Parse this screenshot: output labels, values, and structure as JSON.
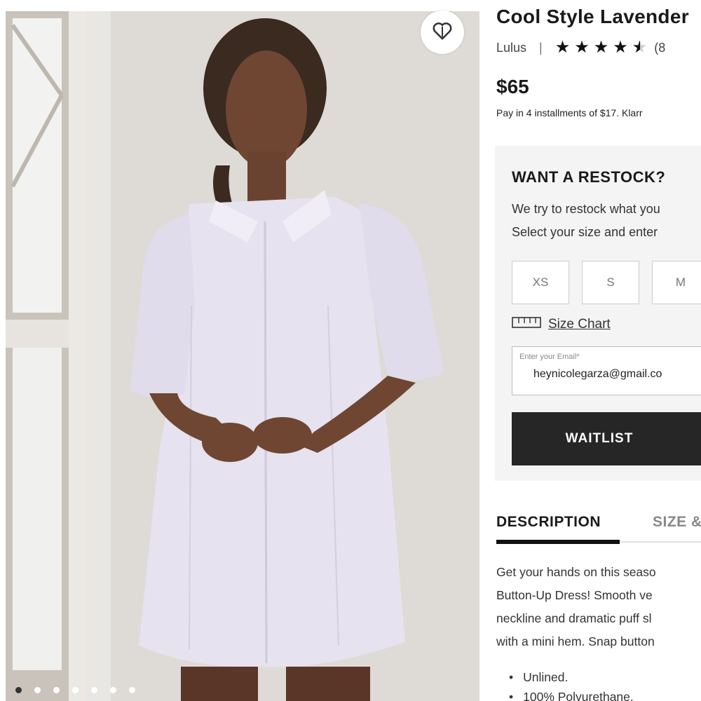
{
  "product": {
    "title": "Cool Style Lavender",
    "brand": "Lulus",
    "separator": "|",
    "rating": 4.5,
    "rating_max": 5,
    "review_count": "(8",
    "price": "$65",
    "installments": "Pay in 4 installments of $17. Klarr"
  },
  "restock": {
    "title": "WANT A RESTOCK?",
    "line1": "We try to restock what you",
    "line2": "Select your size and enter",
    "sizes": [
      "XS",
      "S",
      "M"
    ],
    "size_chart_label": "Size Chart",
    "email_label": "Enter your Email*",
    "email_value": "heynicolegarza@gmail.co",
    "waitlist_label": "WAITLIST"
  },
  "tabs": [
    {
      "label": "DESCRIPTION",
      "active": true
    },
    {
      "label": "SIZE &",
      "active": false
    }
  ],
  "description": {
    "lines": [
      "Get your hands on this seaso",
      "Button-Up Dress! Smooth ve",
      "neckline and dramatic puff sl",
      "with a mini hem. Snap button"
    ],
    "bullets": [
      "Unlined.",
      "100% Polyurethane."
    ]
  },
  "gallery": {
    "dot_count": 7,
    "active_dot": 0
  },
  "icons": {
    "favorite": "heart-icon",
    "size_chart": "ruler-icon",
    "rating": "star-icon"
  },
  "colors": {
    "accent": "#262626",
    "dress": "#e6e2ef",
    "panel_bg": "#f4f4f4"
  }
}
